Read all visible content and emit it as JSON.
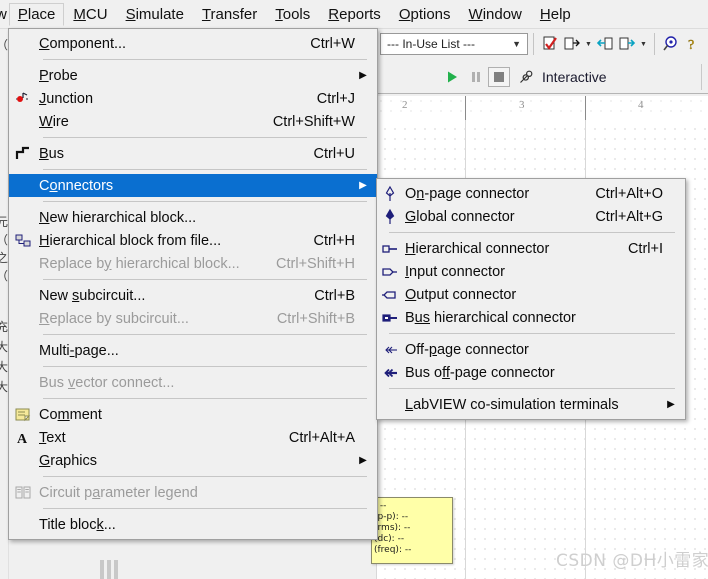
{
  "menubar": {
    "partial_left": "w",
    "items": [
      {
        "label": "Place",
        "mnemonic": "P",
        "active": true
      },
      {
        "label": "MCU",
        "mnemonic": "M",
        "active": false
      },
      {
        "label": "Simulate",
        "mnemonic": "S",
        "active": false
      },
      {
        "label": "Transfer",
        "mnemonic": "T",
        "active": false
      },
      {
        "label": "Tools",
        "mnemonic": "T",
        "active": false
      },
      {
        "label": "Reports",
        "mnemonic": "R",
        "active": false
      },
      {
        "label": "Options",
        "mnemonic": "O",
        "active": false
      },
      {
        "label": "Window",
        "mnemonic": "W",
        "active": false
      },
      {
        "label": "Help",
        "mnemonic": "H",
        "active": false
      }
    ]
  },
  "toolbar": {
    "in_use_list": "--- In-Use List ---",
    "icons": [
      {
        "name": "erc-check-icon"
      },
      {
        "name": "export-netlist-icon"
      },
      {
        "name": "back-annotate-icon"
      },
      {
        "name": "forward-annotate-icon"
      },
      {
        "name": "find-icon"
      },
      {
        "name": "help-icon"
      }
    ]
  },
  "simbar": {
    "run_label": "run",
    "pause_label": "pause",
    "stop_label": "stop",
    "mode_label": "Interactive"
  },
  "place_menu": {
    "items": [
      {
        "label": "Component...",
        "mnemonic": "C",
        "accel": "Ctrl+W",
        "icon": "",
        "state": "normal",
        "submenu": false
      },
      {
        "type": "separator"
      },
      {
        "label": "Probe",
        "mnemonic": "P",
        "accel": "",
        "icon": "",
        "state": "normal",
        "submenu": true
      },
      {
        "label": "Junction",
        "mnemonic": "J",
        "accel": "Ctrl+J",
        "icon": "junction-icon",
        "state": "normal",
        "submenu": false
      },
      {
        "label": "Wire",
        "mnemonic": "W",
        "accel": "Ctrl+Shift+W",
        "icon": "",
        "state": "normal",
        "submenu": false
      },
      {
        "type": "separator"
      },
      {
        "label": "Bus",
        "mnemonic": "B",
        "accel": "Ctrl+U",
        "icon": "bus-icon",
        "state": "normal",
        "submenu": false
      },
      {
        "type": "separator"
      },
      {
        "label": "Connectors",
        "mnemonic": "o",
        "accel": "",
        "icon": "",
        "state": "selected",
        "submenu": true
      },
      {
        "type": "separator"
      },
      {
        "label": "New hierarchical block...",
        "mnemonic": "N",
        "accel": "",
        "icon": "",
        "state": "normal",
        "submenu": false
      },
      {
        "label": "Hierarchical block from file...",
        "mnemonic": "H",
        "accel": "Ctrl+H",
        "icon": "hierarchical-block-icon",
        "state": "normal",
        "submenu": false
      },
      {
        "label": "Replace by hierarchical block...",
        "mnemonic": "y",
        "accel": "Ctrl+Shift+H",
        "icon": "",
        "state": "disabled",
        "submenu": false
      },
      {
        "type": "separator"
      },
      {
        "label": "New subcircuit...",
        "mnemonic": "s",
        "accel": "Ctrl+B",
        "icon": "",
        "state": "normal",
        "submenu": false
      },
      {
        "label": "Replace by subcircuit...",
        "mnemonic": "R",
        "accel": "Ctrl+Shift+B",
        "icon": "",
        "state": "disabled",
        "submenu": false
      },
      {
        "type": "separator"
      },
      {
        "label": "Multi-page...",
        "mnemonic": "-",
        "accel": "",
        "icon": "",
        "state": "normal",
        "submenu": false
      },
      {
        "type": "separator"
      },
      {
        "label": "Bus vector connect...",
        "mnemonic": "v",
        "accel": "",
        "icon": "",
        "state": "disabled",
        "submenu": false
      },
      {
        "type": "separator"
      },
      {
        "label": "Comment",
        "mnemonic": "m",
        "accel": "",
        "icon": "comment-icon",
        "state": "normal",
        "submenu": false
      },
      {
        "label": "Text",
        "mnemonic": "T",
        "accel": "Ctrl+Alt+A",
        "icon": "text-icon",
        "state": "normal",
        "submenu": false
      },
      {
        "label": "Graphics",
        "mnemonic": "G",
        "accel": "",
        "icon": "",
        "state": "normal",
        "submenu": true
      },
      {
        "type": "separator"
      },
      {
        "label": "Circuit parameter legend",
        "mnemonic": "a",
        "accel": "",
        "icon": "legend-icon",
        "state": "disabled",
        "submenu": false
      },
      {
        "type": "separator"
      },
      {
        "label": "Title block...",
        "mnemonic": "k",
        "accel": "",
        "icon": "",
        "state": "normal",
        "submenu": false
      }
    ]
  },
  "connectors_menu": {
    "items": [
      {
        "label": "On-page connector",
        "mnemonic": "n",
        "accel": "Ctrl+Alt+O",
        "icon": "on-page-connector-icon",
        "state": "normal",
        "submenu": false
      },
      {
        "label": "Global connector",
        "mnemonic": "G",
        "accel": "Ctrl+Alt+G",
        "icon": "global-connector-icon",
        "state": "normal",
        "submenu": false
      },
      {
        "type": "separator"
      },
      {
        "label": "Hierarchical connector",
        "mnemonic": "H",
        "accel": "Ctrl+I",
        "icon": "hierarchical-connector-icon",
        "state": "normal",
        "submenu": false
      },
      {
        "label": "Input connector",
        "mnemonic": "I",
        "accel": "",
        "icon": "input-connector-icon",
        "state": "normal",
        "submenu": false
      },
      {
        "label": "Output connector",
        "mnemonic": "O",
        "accel": "",
        "icon": "output-connector-icon",
        "state": "normal",
        "submenu": false
      },
      {
        "label": "Bus hierarchical connector",
        "mnemonic": "us",
        "accel": "",
        "icon": "bus-hierarchical-connector-icon",
        "state": "normal",
        "submenu": false
      },
      {
        "type": "separator"
      },
      {
        "label": "Off-page connector",
        "mnemonic": "p",
        "accel": "",
        "icon": "off-page-connector-icon",
        "state": "normal",
        "submenu": false
      },
      {
        "label": "Bus off-page connector",
        "mnemonic": "ff",
        "accel": "",
        "icon": "bus-off-page-connector-icon",
        "state": "normal",
        "submenu": false
      },
      {
        "type": "separator"
      },
      {
        "label": "LabVIEW co-simulation terminals",
        "mnemonic": "L",
        "accel": "",
        "icon": "",
        "state": "normal",
        "submenu": true
      }
    ]
  },
  "canvas": {
    "ruler_labels": [
      "2",
      "3",
      "4"
    ]
  },
  "probe_tooltip": {
    "lines": [
      ": --",
      "(p-p): --",
      "(rms): --",
      "(dc): --",
      "(freq): --"
    ]
  },
  "watermark": "CSDN @DH小雷家",
  "left_sliver": {
    "glyphs": [
      "（",
      "元",
      "（",
      "之",
      "（",
      "充",
      "大",
      "大",
      "大"
    ]
  },
  "colors": {
    "menu_bg": "#f0f0f0",
    "highlight": "#0a6fd0",
    "icon_navy": "#1f1f7a",
    "disabled_text": "#9b9b9b",
    "probe_bg": "#ffffa8"
  }
}
